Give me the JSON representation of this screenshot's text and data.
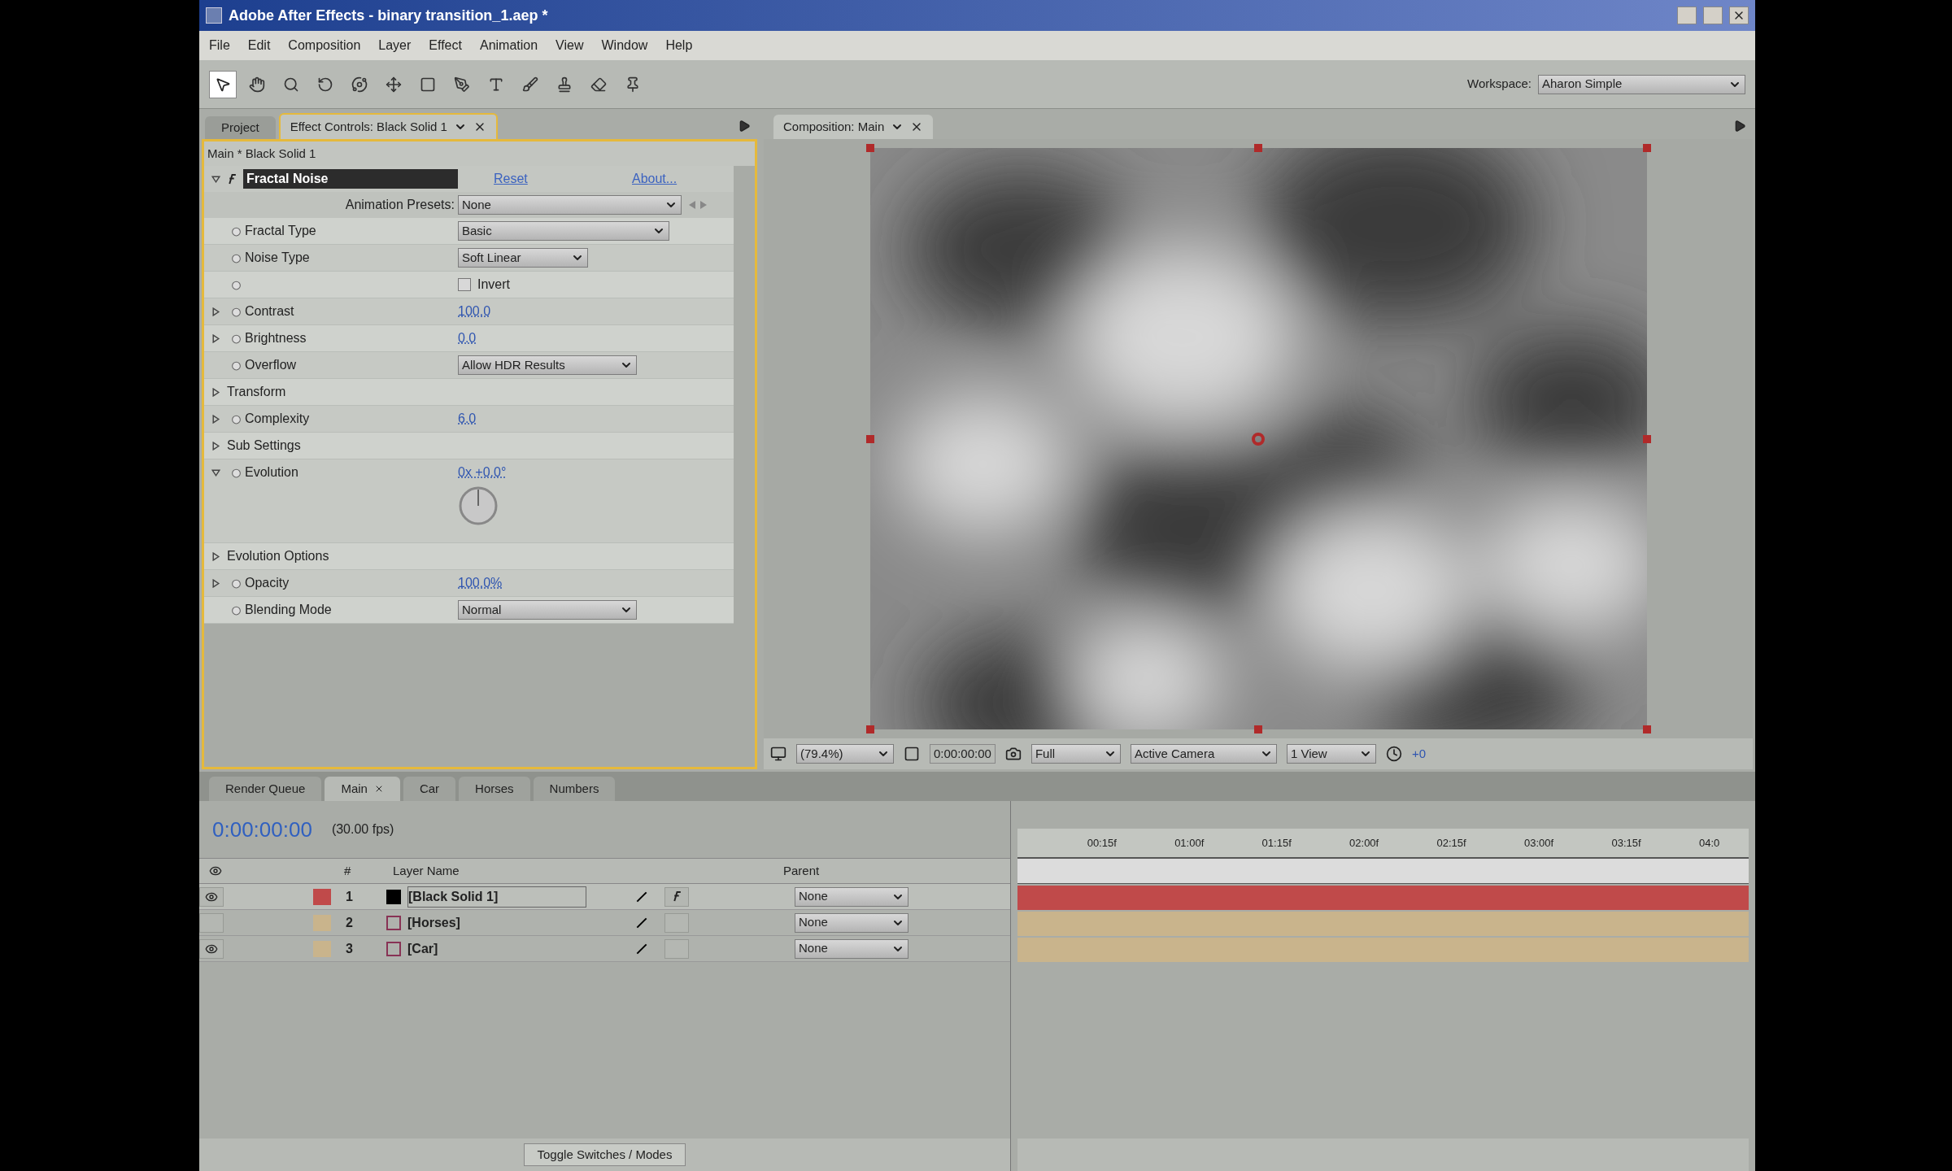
{
  "window": {
    "title": "Adobe After Effects - binary transition_1.aep *"
  },
  "menu": [
    "File",
    "Edit",
    "Composition",
    "Layer",
    "Effect",
    "Animation",
    "View",
    "Window",
    "Help"
  ],
  "workspace": {
    "label": "Workspace:",
    "value": "Aharon Simple"
  },
  "project_tab": {
    "label": "Project",
    "selected": false
  },
  "effect_controls": {
    "tab": "Effect Controls: Black Solid 1",
    "selected": true,
    "breadcrumb": "Main * Black Solid 1",
    "effect": {
      "name": "Fractal Noise",
      "expanded": true,
      "reset": "Reset",
      "about": "About..."
    },
    "presets": {
      "label": "Animation Presets:",
      "value": "None"
    },
    "properties": [
      {
        "kind": "dropdown",
        "label": "Fractal Type",
        "value": "Basic"
      },
      {
        "kind": "dropdown",
        "label": "Noise Type",
        "value": "Soft Linear"
      },
      {
        "kind": "checkbox",
        "value": "Invert",
        "checked": false
      },
      {
        "kind": "number",
        "label": "Contrast",
        "value": "100.0",
        "expanded": false
      },
      {
        "kind": "number",
        "label": "Brightness",
        "value": "0.0",
        "expanded": false
      },
      {
        "kind": "dropdown",
        "label": "Overflow",
        "value": "Allow HDR Results"
      },
      {
        "kind": "group",
        "label": "Transform",
        "expanded": false
      },
      {
        "kind": "number",
        "label": "Complexity",
        "value": "6.0",
        "expanded": false
      },
      {
        "kind": "group",
        "label": "Sub Settings",
        "expanded": false
      },
      {
        "kind": "angle",
        "label": "Evolution",
        "value": "0x +0.0°",
        "expanded": true
      },
      {
        "kind": "group",
        "label": "Evolution Options",
        "expanded": false
      },
      {
        "kind": "number",
        "label": "Opacity",
        "value": "100.0%",
        "expanded": false
      },
      {
        "kind": "dropdown",
        "label": "Blending Mode",
        "value": "Normal"
      }
    ]
  },
  "composition": {
    "tab": "Composition: Main",
    "zoom": "(79.4%)",
    "time": "0:00:00:00",
    "resolution": "Full",
    "camera": "Active Camera",
    "views": "1 View",
    "exposure": "+0"
  },
  "timeline": {
    "tabs": [
      {
        "label": "Render Queue",
        "selected": false
      },
      {
        "label": "Main",
        "selected": true,
        "closable": true
      },
      {
        "label": "Car",
        "selected": false
      },
      {
        "label": "Horses",
        "selected": false
      },
      {
        "label": "Numbers",
        "selected": false
      }
    ],
    "timecode": "0:00:00:00",
    "fps": "(30.00 fps)",
    "columns": {
      "number": "#",
      "name": "Layer Name",
      "parent": "Parent"
    },
    "layers": [
      {
        "number": "1",
        "name": "[Black Solid 1]",
        "kind": "solid",
        "color": "#c04a4a",
        "visible": true,
        "selected": true,
        "effects": true,
        "parent": "None"
      },
      {
        "number": "2",
        "name": "[Horses]",
        "kind": "comp",
        "color": "#c9b48c",
        "visible": false,
        "selected": false,
        "effects": false,
        "parent": "None"
      },
      {
        "number": "3",
        "name": "[Car]",
        "kind": "comp",
        "color": "#c9b48c",
        "visible": true,
        "selected": false,
        "effects": false,
        "parent": "None"
      }
    ],
    "ruler": [
      "00:15f",
      "01:00f",
      "01:15f",
      "02:00f",
      "02:15f",
      "03:00f",
      "03:15f",
      "04:0"
    ],
    "toggle_button": "Toggle Switches / Modes"
  }
}
